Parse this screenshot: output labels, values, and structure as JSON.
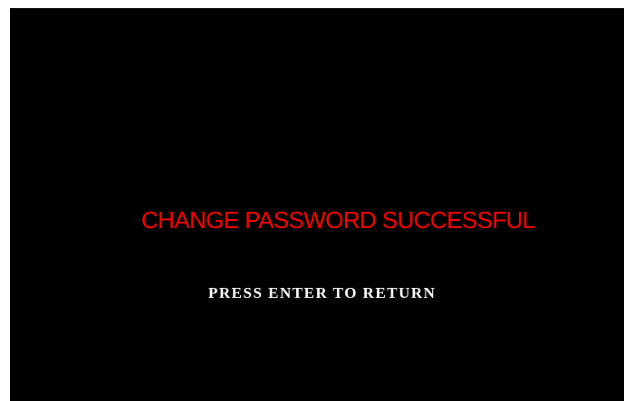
{
  "screen": {
    "background_color": "#000000",
    "message": {
      "text": "CHANGE PASSWORD SUCCESSFUL",
      "color": "#ff0000"
    },
    "prompt": {
      "text": "PRESS ENTER TO RETURN",
      "color": "#ffffff"
    }
  }
}
